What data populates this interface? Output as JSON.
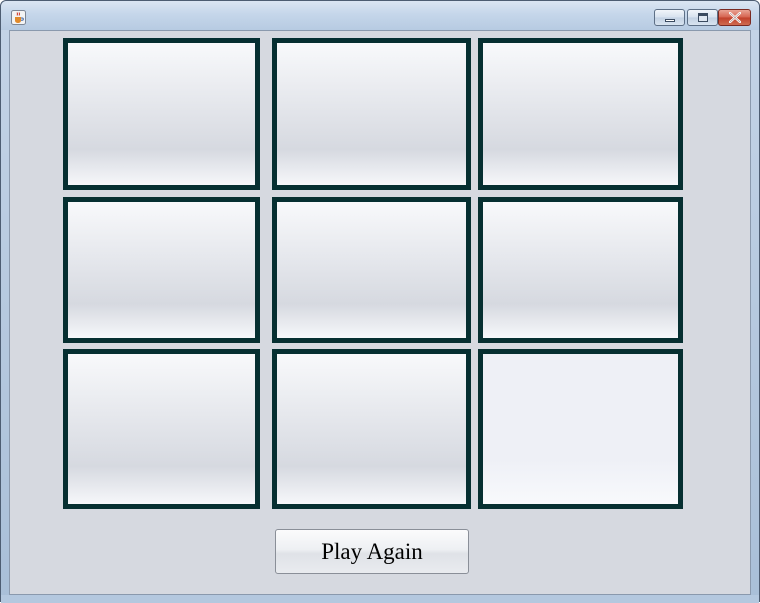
{
  "window": {
    "title": "",
    "icon": "java-coffee-cup-icon",
    "controls": [
      "minimize-icon",
      "maximize-icon",
      "close-icon"
    ]
  },
  "board": {
    "cells": [
      "",
      "",
      "",
      "",
      "",
      "",
      "",
      "",
      ""
    ]
  },
  "play_again_label": "Play Again",
  "colors": {
    "cell_border": "#062f31",
    "panel_background": "#d6d9e0"
  }
}
